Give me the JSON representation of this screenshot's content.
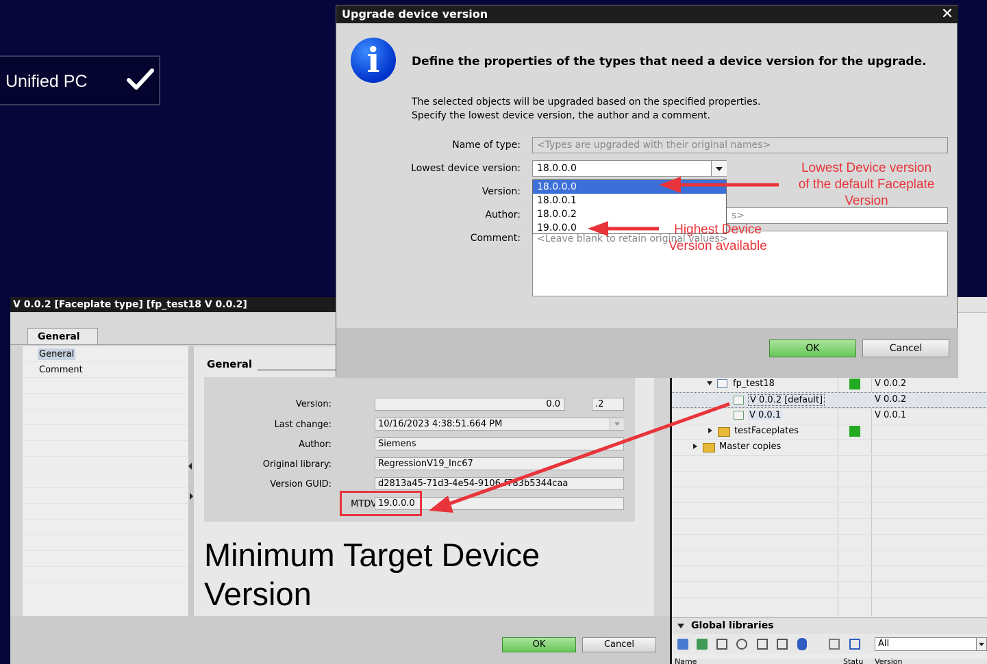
{
  "unified_tile": {
    "label": "Unified PC",
    "icon": "checkmark-icon"
  },
  "faceplate_window": {
    "title": "V 0.0.2 [Faceplate type] [fp_test18 V 0.0.2]",
    "tab": "General",
    "nav_items": [
      "General",
      "Comment"
    ],
    "section_title": "General",
    "properties": {
      "version_label": "Version:",
      "version_major": "0.0",
      "version_minor": ".2",
      "last_change_label": "Last change:",
      "last_change_value": "10/16/2023 4:38:51.664 PM",
      "author_label": "Author:",
      "author_value": "Siemens",
      "original_library_label": "Original library:",
      "original_library_value": "RegressionV19_Inc67",
      "version_guid_label": "Version GUID:",
      "version_guid_value": "d2813a45-71d3-4e54-9106-f783b5344caa",
      "mtdv_label": "MTDV",
      "mtdv_value": "19.0.0.0"
    },
    "annotation": "Minimum Target Device Version",
    "ok_label": "OK",
    "cancel_label": "Cancel"
  },
  "library_panel": {
    "rows": [
      {
        "label": "fp_test18",
        "version": "V 0.0.2"
      },
      {
        "label": "V 0.0.2 [default]",
        "version": "V 0.0.2"
      },
      {
        "label": "V 0.0.1",
        "version": "V 0.0.1"
      },
      {
        "label": "testFaceplates",
        "version": ""
      },
      {
        "label": "Master copies",
        "version": ""
      }
    ],
    "global_libraries_label": "Global libraries",
    "filter_value": "All",
    "col_name": "Name",
    "col_status": "Statu",
    "col_version": "Version"
  },
  "dialog": {
    "title": "Upgrade device version",
    "heading": "Define the properties of the types that need a device version for the upgrade.",
    "text_line1": "The selected objects will be upgraded based on the specified properties.",
    "text_line2": "Specify the lowest device version, the author and a comment.",
    "name_of_type_label": "Name of type:",
    "name_of_type_placeholder": "<Types are upgraded with their original names>",
    "lowest_device_version_label": "Lowest device version:",
    "lowest_device_version_value": "18.0.0.0",
    "version_label": "Version:",
    "author_label": "Author:",
    "author_placeholder_tail": "s>",
    "comment_label": "Comment:",
    "comment_placeholder": "<Leave blank to retain original values>",
    "dropdown_options": [
      "18.0.0.0",
      "18.0.0.1",
      "18.0.0.2",
      "19.0.0.0"
    ],
    "selected_option": "18.0.0.0",
    "ok_label": "OK",
    "cancel_label": "Cancel"
  },
  "notes": {
    "lowest_note_line1": "Lowest Device version",
    "lowest_note_line2": "of the default Faceplate",
    "lowest_note_line3": "Version",
    "highest_note_line1": "Highest Device",
    "highest_note_line2": "Version available"
  },
  "colors": {
    "background": "#06063a",
    "annotation_red": "#e8343a",
    "ok_green": "#68c65a",
    "selection_blue": "#3c6fd8"
  }
}
